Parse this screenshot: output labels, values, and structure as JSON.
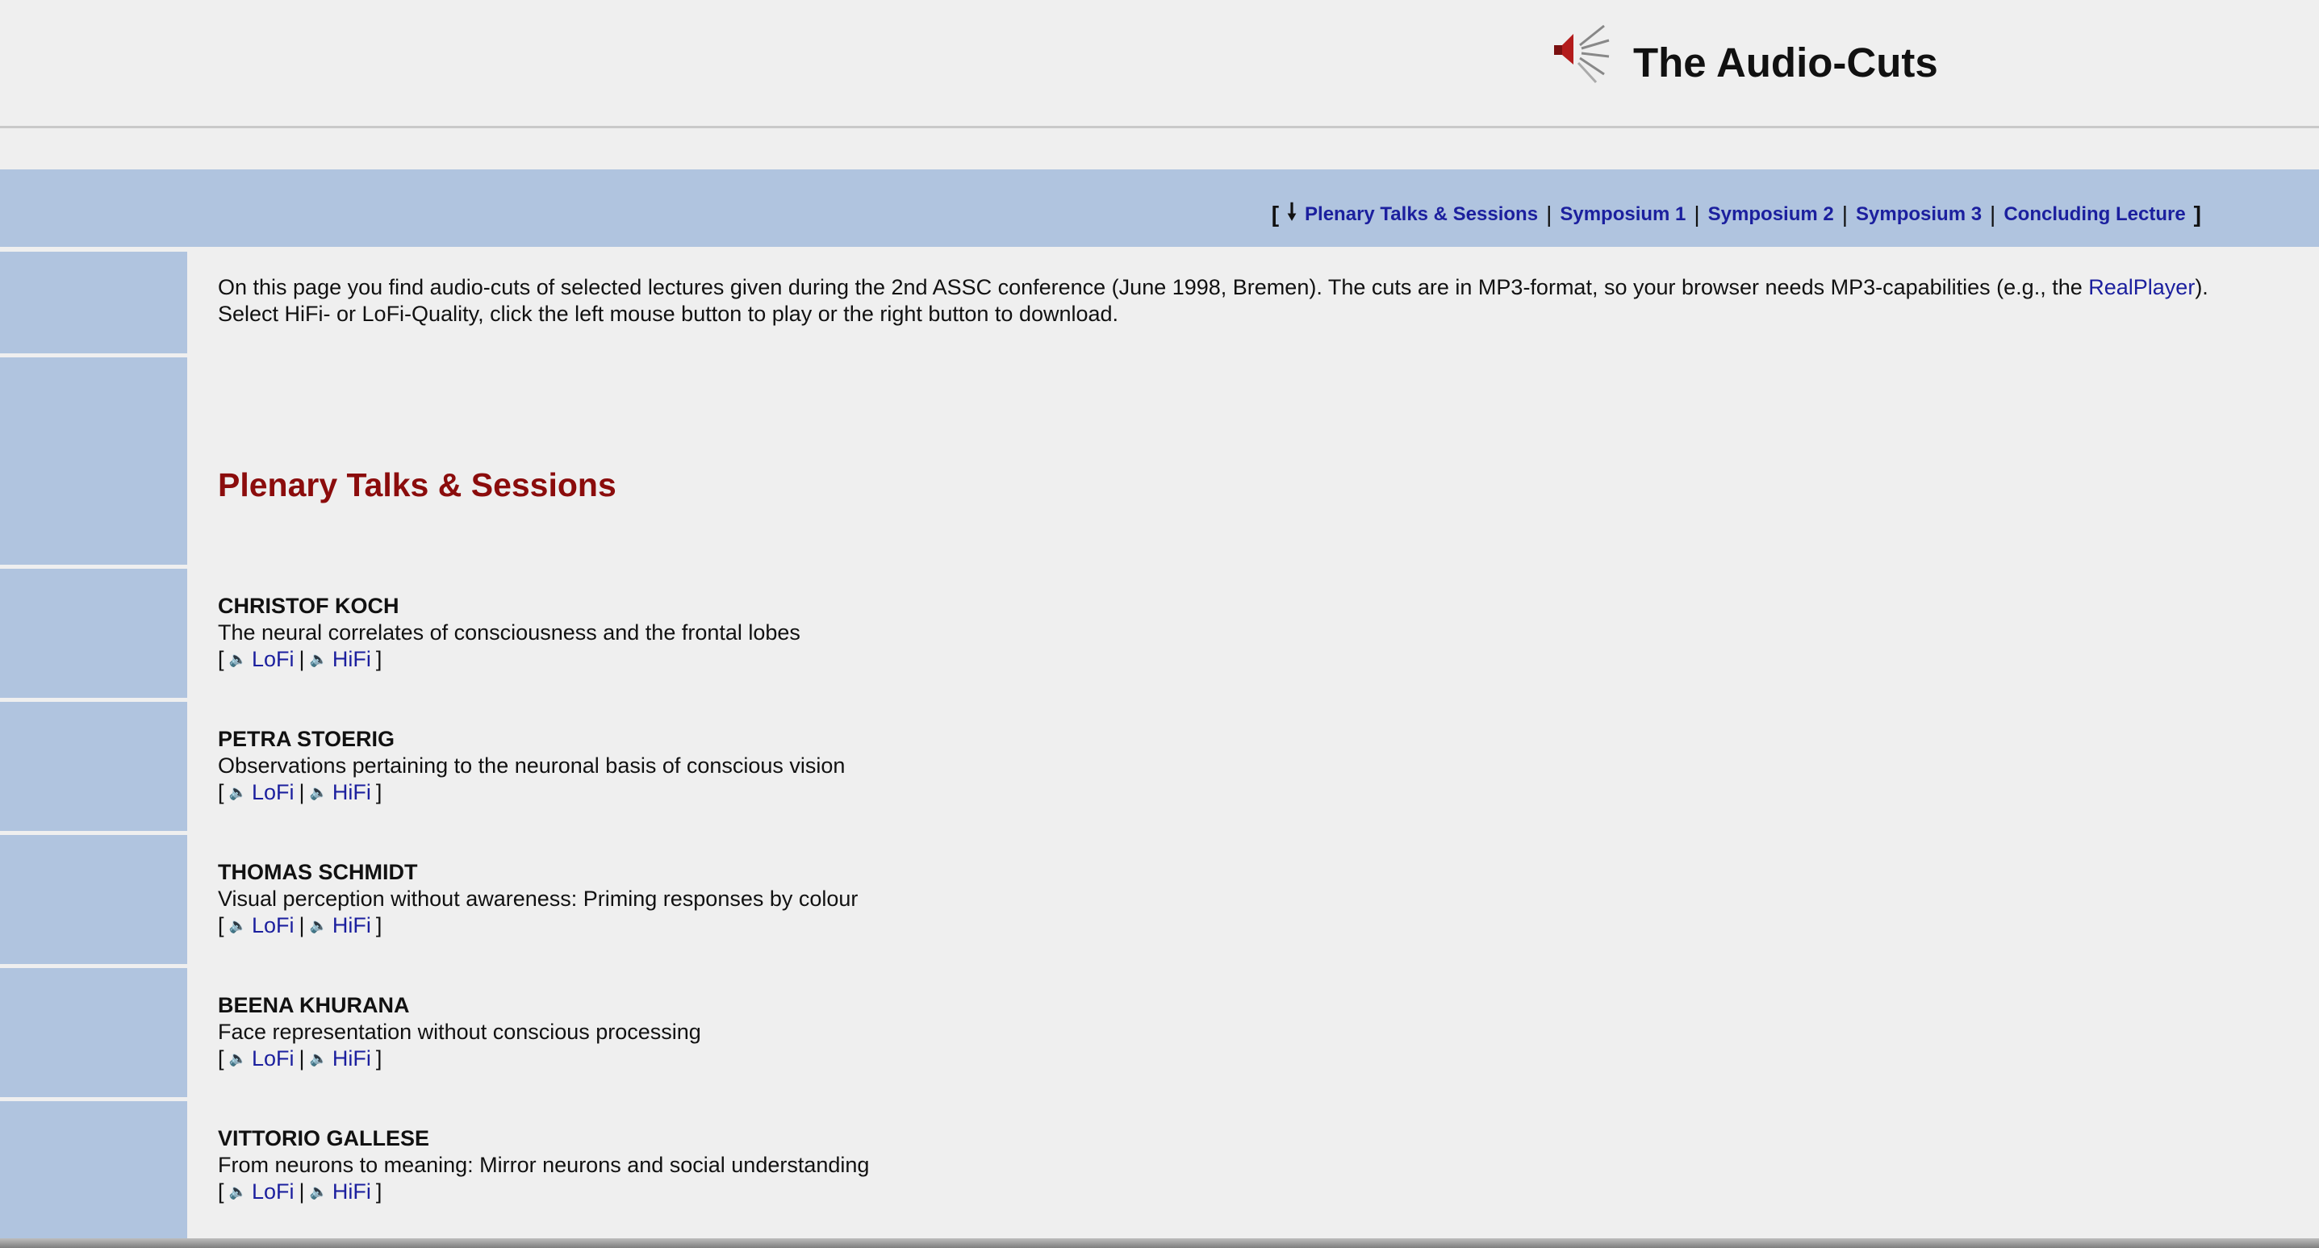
{
  "header": {
    "title": "The Audio-Cuts",
    "logo_icon": "speaker-icon"
  },
  "nav": {
    "open_bracket": "[",
    "arrow": "🠗",
    "items": [
      {
        "label": "Plenary Talks & Sessions"
      },
      {
        "label": "Symposium 1"
      },
      {
        "label": "Symposium 2"
      },
      {
        "label": "Symposium 3"
      },
      {
        "label": "Concluding Lecture"
      }
    ],
    "separator": "|",
    "close_bracket": "]"
  },
  "intro": {
    "text_before_link": "On this page you find audio-cuts of selected lectures given during the 2nd ASSC conference (June 1998, Bremen). The cuts are in MP3-format, so your browser needs MP3-capabilities (e.g., the ",
    "link": "RealPlayer",
    "text_after_link": ").",
    "line2": "Select HiFi- or LoFi-Quality, click the left mouse button to play or the right button to download."
  },
  "section": {
    "title": "Plenary Talks & Sessions"
  },
  "link_labels": {
    "open": "[",
    "lofi": "LoFi",
    "sep": "|",
    "hifi": "HiFi",
    "close": "]",
    "speaker_glyph": "🔈"
  },
  "talks": [
    {
      "speaker": "CHRISTOF KOCH",
      "title": "The neural correlates of consciousness and the frontal lobes"
    },
    {
      "speaker": "PETRA STOERIG",
      "title": "Observations pertaining to the neuronal basis of conscious vision"
    },
    {
      "speaker": "THOMAS SCHMIDT",
      "title": "Visual perception without awareness: Priming responses by colour"
    },
    {
      "speaker": "BEENA KHURANA",
      "title": "Face representation without conscious processing"
    },
    {
      "speaker": "VITTORIO GALLESE",
      "title": "From neurons to meaning: Mirror neurons and social understanding"
    }
  ],
  "colors": {
    "band": "#b0c4df",
    "link": "#1b1f9e",
    "section_title": "#8b0c0c",
    "background": "#efefef"
  }
}
